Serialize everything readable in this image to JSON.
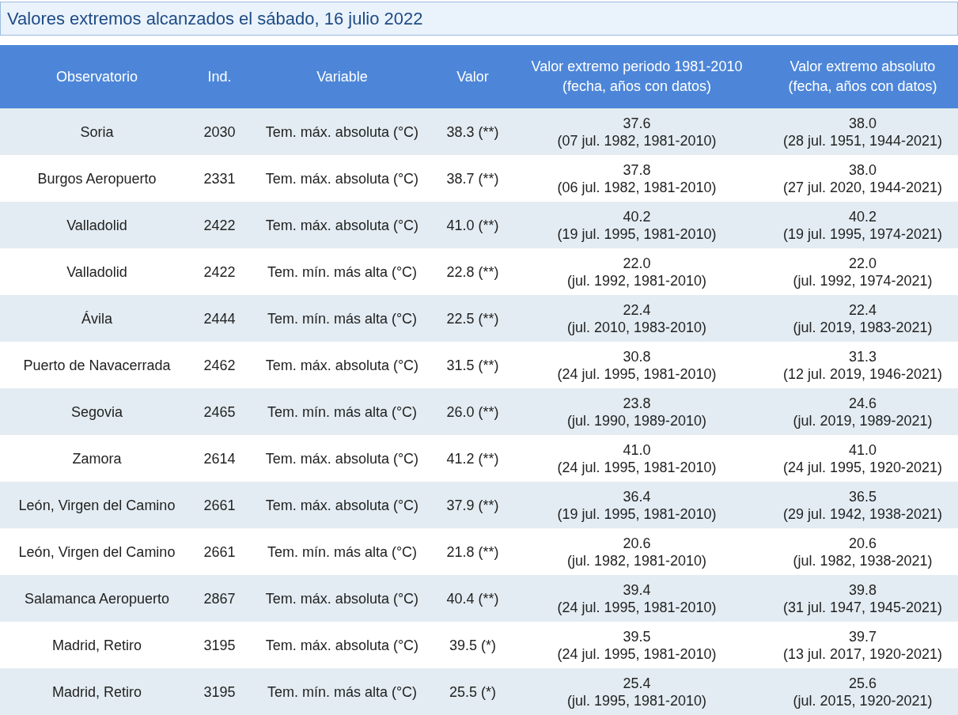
{
  "title": "Valores extremos alcanzados el sábado, 16 julio 2022",
  "columns": [
    {
      "label": "Observatorio"
    },
    {
      "label": "Ind."
    },
    {
      "label": "Variable"
    },
    {
      "label": "Valor"
    },
    {
      "label": "Valor extremo periodo 1981-2010",
      "sub": "(fecha, años con datos)"
    },
    {
      "label": "Valor extremo absoluto",
      "sub": "(fecha, años con datos)"
    }
  ],
  "rows": [
    {
      "station": "Soria",
      "ind": "2030",
      "variable": "Tem. máx. absoluta (°C)",
      "value": "38.3 (**)",
      "period": {
        "value": "37.6",
        "detail": "(07 jul. 1982, 1981-2010)"
      },
      "absolute": {
        "value": "38.0",
        "detail": "(28 jul. 1951, 1944-2021)"
      }
    },
    {
      "station": "Burgos Aeropuerto",
      "ind": "2331",
      "variable": "Tem. máx. absoluta (°C)",
      "value": "38.7 (**)",
      "period": {
        "value": "37.8",
        "detail": "(06 jul. 1982, 1981-2010)"
      },
      "absolute": {
        "value": "38.0",
        "detail": "(27 jul. 2020, 1944-2021)"
      }
    },
    {
      "station": "Valladolid",
      "ind": "2422",
      "variable": "Tem. máx. absoluta (°C)",
      "value": "41.0 (**)",
      "period": {
        "value": "40.2",
        "detail": "(19 jul. 1995, 1981-2010)"
      },
      "absolute": {
        "value": "40.2",
        "detail": "(19 jul. 1995, 1974-2021)"
      }
    },
    {
      "station": "Valladolid",
      "ind": "2422",
      "variable": "Tem. mín. más alta (°C)",
      "value": "22.8 (**)",
      "period": {
        "value": "22.0",
        "detail": "(jul. 1992, 1981-2010)"
      },
      "absolute": {
        "value": "22.0",
        "detail": "(jul. 1992, 1974-2021)"
      }
    },
    {
      "station": "Ávila",
      "ind": "2444",
      "variable": "Tem. mín. más alta (°C)",
      "value": "22.5 (**)",
      "period": {
        "value": "22.4",
        "detail": "(jul. 2010, 1983-2010)"
      },
      "absolute": {
        "value": "22.4",
        "detail": "(jul. 2019, 1983-2021)"
      }
    },
    {
      "station": "Puerto de Navacerrada",
      "ind": "2462",
      "variable": "Tem. máx. absoluta (°C)",
      "value": "31.5 (**)",
      "period": {
        "value": "30.8",
        "detail": "(24 jul. 1995, 1981-2010)"
      },
      "absolute": {
        "value": "31.3",
        "detail": "(12 jul. 2019, 1946-2021)"
      }
    },
    {
      "station": "Segovia",
      "ind": "2465",
      "variable": "Tem. mín. más alta (°C)",
      "value": "26.0 (**)",
      "period": {
        "value": "23.8",
        "detail": "(jul. 1990, 1989-2010)"
      },
      "absolute": {
        "value": "24.6",
        "detail": "(jul. 2019, 1989-2021)"
      }
    },
    {
      "station": "Zamora",
      "ind": "2614",
      "variable": "Tem. máx. absoluta (°C)",
      "value": "41.2 (**)",
      "period": {
        "value": "41.0",
        "detail": "(24 jul. 1995, 1981-2010)"
      },
      "absolute": {
        "value": "41.0",
        "detail": "(24 jul. 1995, 1920-2021)"
      }
    },
    {
      "station": "León, Virgen del Camino",
      "ind": "2661",
      "variable": "Tem. máx. absoluta (°C)",
      "value": "37.9 (**)",
      "period": {
        "value": "36.4",
        "detail": "(19 jul. 1995, 1981-2010)"
      },
      "absolute": {
        "value": "36.5",
        "detail": "(29 jul. 1942, 1938-2021)"
      }
    },
    {
      "station": "León, Virgen del Camino",
      "ind": "2661",
      "variable": "Tem. mín. más alta (°C)",
      "value": "21.8 (**)",
      "period": {
        "value": "20.6",
        "detail": "(jul. 1982, 1981-2010)"
      },
      "absolute": {
        "value": "20.6",
        "detail": "(jul. 1982, 1938-2021)"
      }
    },
    {
      "station": "Salamanca Aeropuerto",
      "ind": "2867",
      "variable": "Tem. máx. absoluta (°C)",
      "value": "40.4 (**)",
      "period": {
        "value": "39.4",
        "detail": "(24 jul. 1995, 1981-2010)"
      },
      "absolute": {
        "value": "39.8",
        "detail": "(31 jul. 1947, 1945-2021)"
      }
    },
    {
      "station": "Madrid, Retiro",
      "ind": "3195",
      "variable": "Tem. máx. absoluta (°C)",
      "value": "39.5 (*)",
      "period": {
        "value": "39.5",
        "detail": "(24 jul. 1995, 1981-2010)"
      },
      "absolute": {
        "value": "39.7",
        "detail": "(13 jul. 2017, 1920-2021)"
      }
    },
    {
      "station": "Madrid, Retiro",
      "ind": "3195",
      "variable": "Tem. mín. más alta (°C)",
      "value": "25.5 (*)",
      "period": {
        "value": "25.4",
        "detail": "(jul. 1995, 1981-2010)"
      },
      "absolute": {
        "value": "25.6",
        "detail": "(jul. 2015, 1920-2021)"
      }
    }
  ]
}
